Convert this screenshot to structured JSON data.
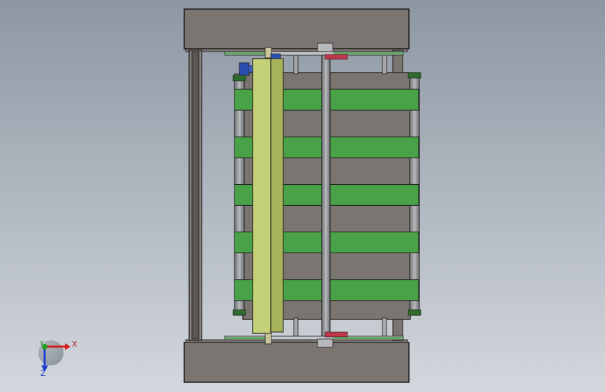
{
  "viewport": {
    "background_top": "#8d97a3",
    "background_bottom": "#d3d7dd"
  },
  "model": {
    "frame_color": "#7b7571",
    "belt_color": "#4aa248",
    "roller_color": "#a6a7ab",
    "panel_color": "#c5d178",
    "motor_color": "#2a4fb0",
    "bearing_red": "#c0364a",
    "outline_color": "#1a1a1a",
    "belt_count": 5
  },
  "triad": {
    "x_label": "X",
    "y_label": "Y",
    "z_label": "Z",
    "x_color": "#d21e1e",
    "y_color": "#1fa31f",
    "z_color": "#1f3fd0"
  }
}
